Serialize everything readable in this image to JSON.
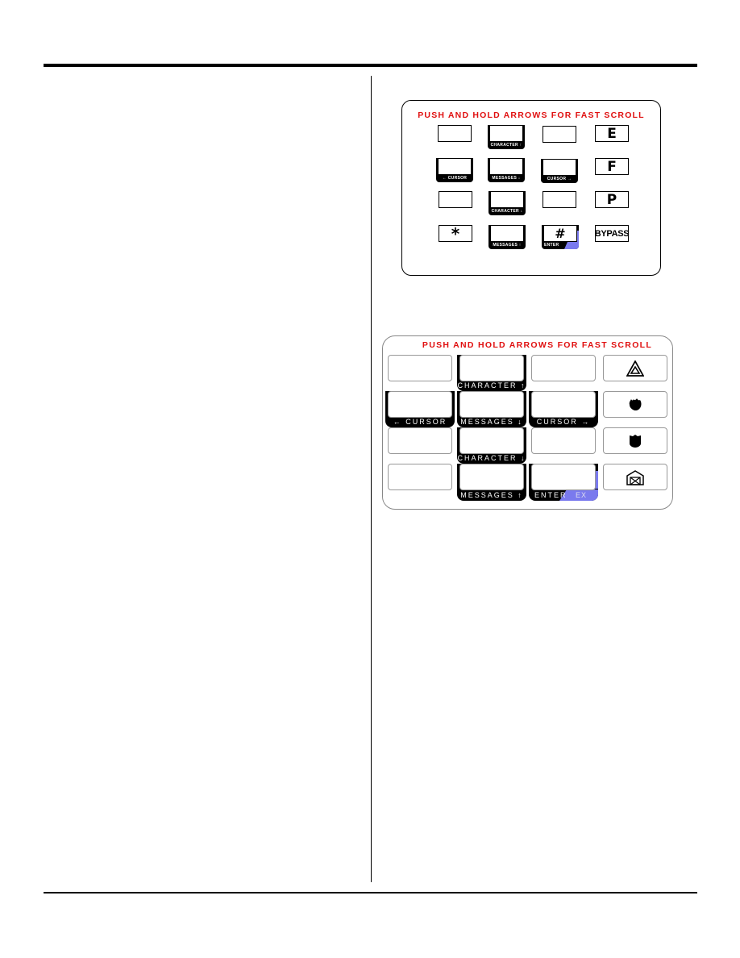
{
  "keypad_1": {
    "title": "PUSH AND HOLD ARROWS FOR FAST SCROLL",
    "keys": {
      "r1c2_label": "CHARACTER ↑",
      "r1c4": "E",
      "r2c1_label": "← CURSOR",
      "r2c2_label": "MESSAGES ↓",
      "r2c3_label": "CURSOR →",
      "r2c4": "F",
      "r3c2_label": "CHARACTER ↓",
      "r3c4": "P",
      "r4c1": "*",
      "r4c2_label": "MESSAGES ↑",
      "r4c3": "#",
      "r4c3_label": "ENTER",
      "r4c4": "BYPASS"
    }
  },
  "keypad_2": {
    "title": "PUSH AND HOLD ARROWS FOR FAST SCROLL",
    "keys": {
      "r1c2_label": "CHARACTER ↑",
      "r1c4_icon": "hazard-triangle-icon",
      "r2c1_label": "← CURSOR",
      "r2c2_label": "MESSAGES ↓",
      "r2c3_label": "CURSOR →",
      "r2c4_icon": "fire-icon",
      "r3c2_label": "CHARACTER ↓",
      "r3c4_icon": "police-shield-icon",
      "r4c2_label": "MESSAGES ↑",
      "r4c3_label": "ENTER",
      "r4c3_ex_label": "EX",
      "r4c4_icon": "house-envelope-icon"
    }
  },
  "colors": {
    "title_red": "#e01010",
    "ex_blue": "#7a7aee"
  }
}
